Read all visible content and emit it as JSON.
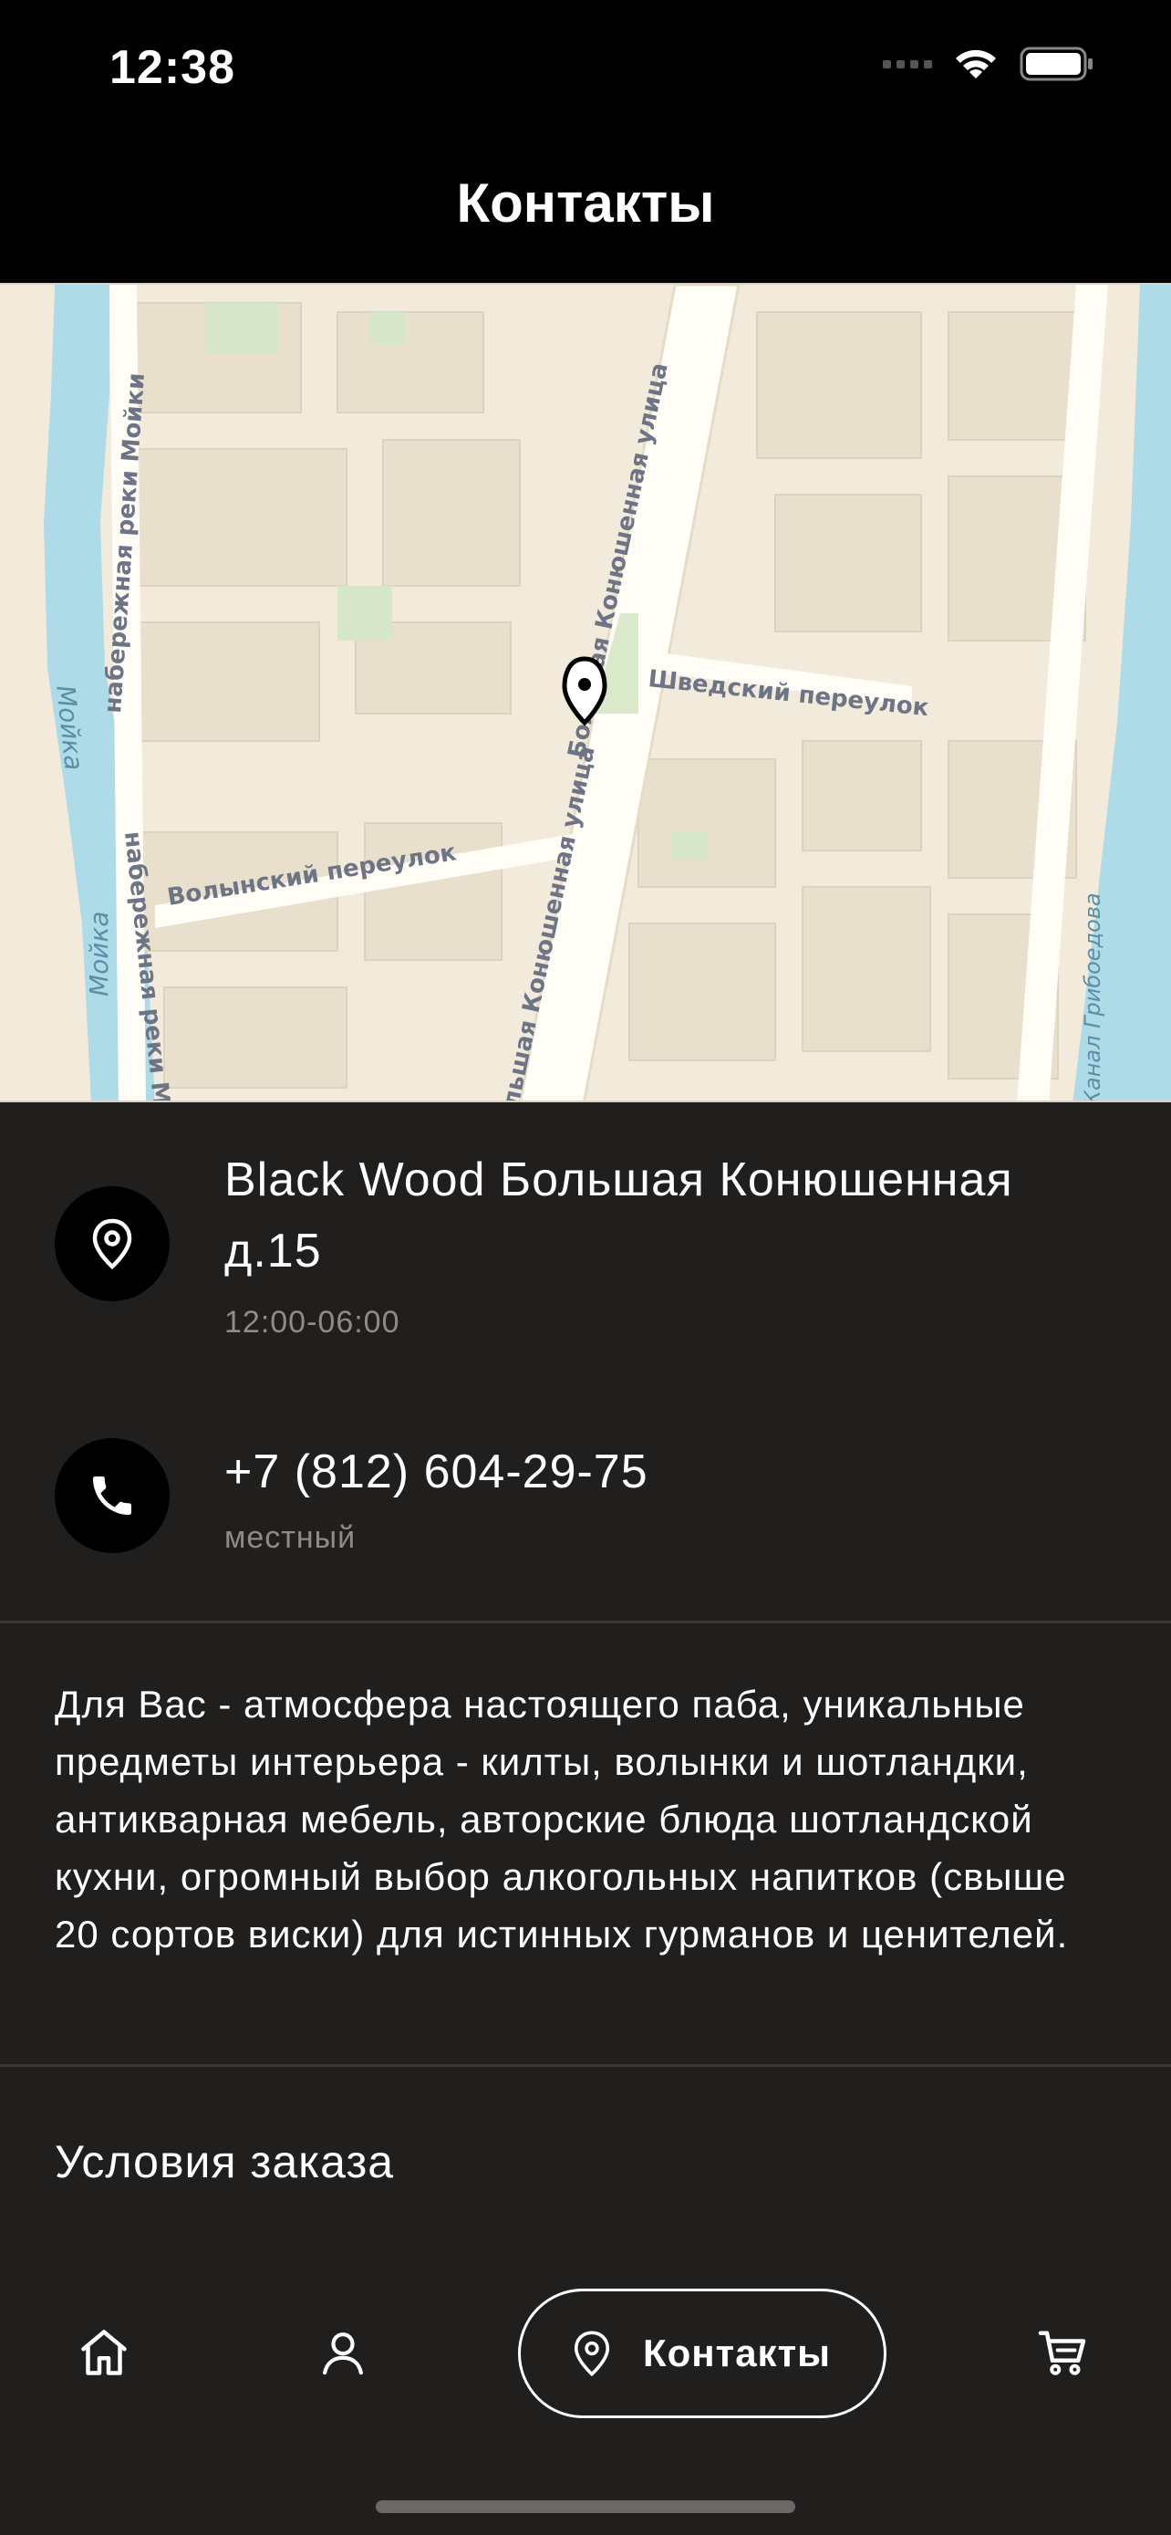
{
  "status_bar": {
    "time": "12:38"
  },
  "header": {
    "title": "Контакты"
  },
  "map": {
    "labels": {
      "main_street": "Большая Конюшенная улица",
      "main_street_lower": "Большая Конюшенная улица",
      "shvedsky": "Шведский переулок",
      "volynsky": "Волынский переулок",
      "embankment_upper": "набережная реки Мойки",
      "embankment_lower": "набережная реки Мойки",
      "river": "Мойка",
      "river_lower": "Мойка",
      "right_edge": "Канал Грибоедова"
    }
  },
  "address": {
    "title": "Black Wood Большая Конюшенная д.15",
    "hours": "12:00-06:00"
  },
  "phone": {
    "number": "+7 (812) 604-29-75",
    "type": "местный"
  },
  "description": "Для Вас - атмосфера настоящего паба, уникальные предметы интерьера - килты, волынки и шотландки, антикварная мебель, авторские блюда шотландской кухни, огромный выбор алкогольных напитков (свыше 20 сортов виски) для истинных гурманов и ценителей.",
  "order_terms": "Условия заказа",
  "tabbar": {
    "items": [
      {
        "id": "home",
        "icon": "home-icon"
      },
      {
        "id": "profile",
        "icon": "user-icon"
      },
      {
        "id": "contacts",
        "icon": "location-pin-icon",
        "label": "Контакты",
        "active": true
      },
      {
        "id": "cart",
        "icon": "cart-icon"
      }
    ]
  }
}
